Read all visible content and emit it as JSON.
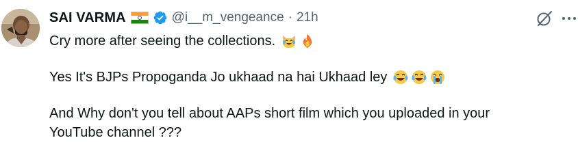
{
  "tweet": {
    "display_name": "SAI VARMA",
    "handle": "@i__m_vengeance",
    "separator": "·",
    "time": "21h",
    "flag_icon": "india-flag-icon",
    "verified_icon": "verified-badge-icon",
    "grok_icon": "grok-icon",
    "more_icon": "more-options-icon",
    "colors": {
      "text": "#0f1419",
      "muted": "#536471",
      "verified": "#1d9bf0"
    },
    "lines": [
      "Cry more after seeing the collections.",
      "Yes It's BJPs Propoganda Jo ukhaad na hai Ukhaad ley",
      "And Why don't you tell about AAPs short film which you uploaded in your",
      "YouTube channel ???"
    ],
    "line1_emojis": [
      "tears-of-joy-cat-emoji",
      "fire-emoji"
    ],
    "line2_emojis": [
      "tears-of-joy-emoji",
      "tears-of-joy-emoji",
      "loudly-crying-emoji"
    ]
  }
}
